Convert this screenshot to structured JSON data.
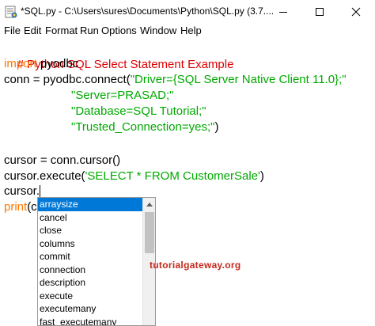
{
  "window": {
    "title": "*SQL.py - C:\\Users\\sures\\Documents\\Python\\SQL.py (3.7....",
    "controls": {
      "minimize": "minimize",
      "maximize": "maximize",
      "close": "close"
    }
  },
  "menu": [
    "File",
    "Edit",
    "Format",
    "Run",
    "Options",
    "Window",
    "Help"
  ],
  "code": {
    "line1": "# Python SQL Select Statement Example",
    "line2_kw": "import",
    "line2_rest": " pyodbc",
    "line3_pre": "conn = pyodbc.connect(",
    "line3_str": "\"Driver={SQL Server Native Client 11.0};\"",
    "line4_str": "\"Server=PRASAD;\"",
    "line5_str": "\"Database=SQL Tutorial;\"",
    "line6_str": "\"Trusted_Connection=yes;\"",
    "line6_post": ")",
    "line8": "cursor = conn.cursor()",
    "line9_pre": "cursor.execute(",
    "line9_str": "'SELECT * FROM CustomerSale'",
    "line9_post": ")",
    "line10": "cursor.",
    "line11_kw": "print",
    "line11_rest": "(c"
  },
  "autocomplete": {
    "items": [
      "arraysize",
      "cancel",
      "close",
      "columns",
      "commit",
      "connection",
      "description",
      "execute",
      "executemany",
      "fast_executemany"
    ],
    "selected": "arraysize"
  },
  "watermark": "tutorialgateway.org",
  "colors": {
    "comment": "#dd0000",
    "keyword": "#ff7700",
    "string": "#00aa00",
    "selection": "#0078d7"
  }
}
